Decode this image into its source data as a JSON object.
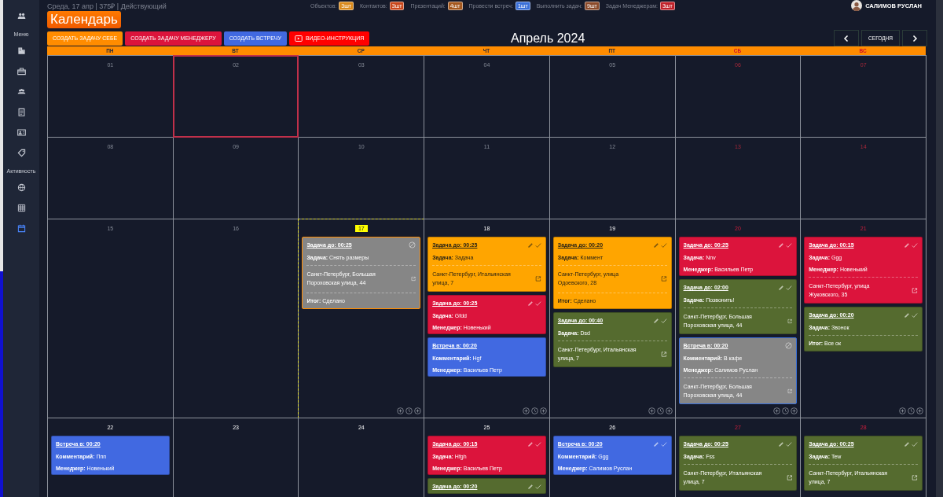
{
  "header": {
    "info": "Среда, 17 апр | 375₽ | Действующий",
    "counters": [
      {
        "label": "Объектов:",
        "count": "3шт",
        "color": "#d98a1c"
      },
      {
        "label": "Контактов:",
        "count": "3шт",
        "color": "#c8471c"
      },
      {
        "label": "Презентаций:",
        "count": "4шт",
        "color": "#a4581e"
      },
      {
        "label": "Провести встреч:",
        "count": "1шт",
        "color": "#3a6fd8"
      },
      {
        "label": "Выполнить задач:",
        "count": "9шт",
        "color": "#8b4a2a"
      },
      {
        "label": "Задач Менеджерам:",
        "count": "3шт",
        "color": "#c0222a"
      }
    ],
    "user": {
      "name": "САЛИМОВ РУСЛАН"
    }
  },
  "sidebar": {
    "top_items": [
      {
        "selected": false
      }
    ],
    "sections": [
      {
        "label": "Меню",
        "items": [
          {
            "selected": false
          },
          {
            "selected": false
          },
          {
            "selected": false
          },
          {
            "selected": false
          },
          {
            "selected": false
          },
          {
            "selected": false
          }
        ]
      },
      {
        "label": "Активность",
        "items": [
          {
            "selected": false
          },
          {
            "selected": false
          },
          {
            "selected": true
          }
        ]
      }
    ]
  },
  "title": "Календарь",
  "buttons": [
    {
      "label": "СОЗДАТЬ ЗАДАЧУ СЕБЕ",
      "color": "#ff8c00",
      "kind": "plain"
    },
    {
      "label": "СОЗДАТЬ ЗАДАЧУ МЕНЕДЖЕРУ",
      "color": "#dc143c",
      "kind": "plain"
    },
    {
      "label": "СОЗДАТЬ ВСТРЕЧУ",
      "color": "#4169e1",
      "kind": "plain"
    },
    {
      "label": "ВИДЕО-ИНСТРУКЦИЯ",
      "color": "#ff0000",
      "kind": "video"
    }
  ],
  "month": "Апрель 2024",
  "today_button": "СЕГОДНЯ",
  "weekdays": [
    {
      "label": "ПН",
      "weekend": false
    },
    {
      "label": "ВТ",
      "weekend": false
    },
    {
      "label": "СР",
      "weekend": false
    },
    {
      "label": "ЧТ",
      "weekend": false
    },
    {
      "label": "ПТ",
      "weekend": false
    },
    {
      "label": "СБ",
      "weekend": true
    },
    {
      "label": "ВС",
      "weekend": true
    }
  ],
  "weeks": [
    [
      {
        "number": "01",
        "past": true,
        "weekend": false,
        "today": false,
        "selected": false,
        "actions": false
      },
      {
        "number": "02",
        "past": true,
        "weekend": false,
        "today": false,
        "selected": true,
        "actions": false
      },
      {
        "number": "03",
        "past": true,
        "weekend": false,
        "today": false,
        "selected": false,
        "actions": false
      },
      {
        "number": "04",
        "past": true,
        "weekend": false,
        "today": false,
        "selected": false,
        "actions": false
      },
      {
        "number": "05",
        "past": true,
        "weekend": false,
        "today": false,
        "selected": false,
        "actions": false
      },
      {
        "number": "06",
        "past": true,
        "weekend": true,
        "today": false,
        "selected": false,
        "actions": false
      },
      {
        "number": "07",
        "past": true,
        "weekend": true,
        "today": false,
        "selected": false,
        "actions": false
      }
    ],
    [
      {
        "number": "08",
        "past": true,
        "weekend": false,
        "today": false,
        "selected": false,
        "actions": false
      },
      {
        "number": "09",
        "past": true,
        "weekend": false,
        "today": false,
        "selected": false,
        "actions": false
      },
      {
        "number": "10",
        "past": true,
        "weekend": false,
        "today": false,
        "selected": false,
        "actions": false
      },
      {
        "number": "11",
        "past": true,
        "weekend": false,
        "today": false,
        "selected": false,
        "actions": false
      },
      {
        "number": "12",
        "past": true,
        "weekend": false,
        "today": false,
        "selected": false,
        "actions": false
      },
      {
        "number": "13",
        "past": true,
        "weekend": true,
        "today": false,
        "selected": false,
        "actions": false
      },
      {
        "number": "14",
        "past": true,
        "weekend": true,
        "today": false,
        "selected": false,
        "actions": false
      }
    ],
    [
      {
        "number": "15",
        "past": true,
        "weekend": false,
        "today": false,
        "selected": false,
        "actions": false
      },
      {
        "number": "16",
        "past": true,
        "weekend": false,
        "today": false,
        "selected": false,
        "actions": false
      },
      {
        "number": "17",
        "past": false,
        "weekend": false,
        "today": true,
        "selected": false,
        "actions": true,
        "events": [
          {
            "kind": "task",
            "cancelled": true,
            "editable": false,
            "color": "#868686",
            "title": "Задача до: 00:25",
            "lines": [
              {
                "label": "Задача:",
                "value": "Снять размеры"
              }
            ],
            "address": "Санкт-Петербург, Большая Пороховская улица, 44",
            "result": {
              "label": "Итог:",
              "value": "Сделано"
            }
          }
        ]
      },
      {
        "number": "18",
        "past": false,
        "weekend": false,
        "today": false,
        "selected": false,
        "actions": true,
        "events": [
          {
            "kind": "task",
            "cancelled": false,
            "editable": true,
            "color": "#ffa500",
            "title": "Задача до: 00:25",
            "lines": [
              {
                "label": "Задача:",
                "value": "Задача"
              }
            ],
            "address": "Санкт-Петербург, Итальянская улица, 7"
          },
          {
            "kind": "task",
            "cancelled": false,
            "editable": true,
            "color": "#dc143c",
            "title": "Задача до: 00:25",
            "lines": [
              {
                "label": "Задача:",
                "value": "Gfdd"
              },
              {
                "label": "Менеджер:",
                "value": "Новенький"
              }
            ]
          },
          {
            "kind": "meeting",
            "cancelled": false,
            "editable": false,
            "color": "#4169e1",
            "title": "Встреча в: 00:20",
            "lines": [
              {
                "label": "Комментарий:",
                "value": "Hgf"
              },
              {
                "label": "Менеджер:",
                "value": "Васильев Петр"
              }
            ]
          }
        ]
      },
      {
        "number": "19",
        "past": false,
        "weekend": false,
        "today": false,
        "selected": false,
        "actions": true,
        "events": [
          {
            "kind": "task",
            "cancelled": false,
            "editable": true,
            "color": "#ffa500",
            "title": "Задача до: 00:20",
            "lines": [
              {
                "label": "Задача:",
                "value": "Коммент"
              }
            ],
            "address": "Санкт-Петербург, улица Одоевского, 28",
            "result": {
              "label": "Итог:",
              "value": "Сделано"
            }
          },
          {
            "kind": "task",
            "cancelled": false,
            "editable": true,
            "color": "#556b2f",
            "title": "Задача до: 00:40",
            "lines": [
              {
                "label": "Задача:",
                "value": "Dsd"
              }
            ],
            "address": "Санкт-Петербург, Итальянская улица, 7"
          }
        ]
      },
      {
        "number": "20",
        "past": false,
        "weekend": true,
        "today": false,
        "selected": false,
        "actions": true,
        "events": [
          {
            "kind": "task",
            "cancelled": false,
            "editable": true,
            "color": "#dc143c",
            "title": "Задача до: 00:25",
            "lines": [
              {
                "label": "Задача:",
                "value": "Nnv"
              },
              {
                "label": "Менеджер:",
                "value": "Васильев Петр"
              }
            ]
          },
          {
            "kind": "task",
            "cancelled": false,
            "editable": true,
            "color": "#556b2f",
            "title": "Задача до: 02:00",
            "lines": [
              {
                "label": "Задача:",
                "value": "Позвонить!"
              }
            ],
            "address": "Санкт-Петербург, Большая Пороховская улица, 44"
          },
          {
            "kind": "meeting",
            "cancelled": true,
            "editable": false,
            "color": "#868686",
            "title": "Встреча в: 00:20",
            "lines": [
              {
                "label": "Комментарий:",
                "value": "В кафе"
              },
              {
                "label": "Менеджер:",
                "value": "Салимов Руслан"
              }
            ],
            "address": "Санкт-Петербург, Большая Пороховская улица, 44"
          }
        ]
      },
      {
        "number": "21",
        "past": false,
        "weekend": true,
        "today": false,
        "selected": false,
        "actions": true,
        "events": [
          {
            "kind": "task",
            "cancelled": false,
            "editable": true,
            "color": "#dc143c",
            "title": "Задача до: 00:15",
            "lines": [
              {
                "label": "Задача:",
                "value": "Ggg"
              },
              {
                "label": "Менеджер:",
                "value": "Новенький"
              }
            ],
            "address": "Санкт-Петербург, улица Жуковского, 35"
          },
          {
            "kind": "task",
            "cancelled": false,
            "editable": true,
            "color": "#556b2f",
            "title": "Задача до: 00:20",
            "lines": [
              {
                "label": "Задача:",
                "value": "Звонок"
              }
            ],
            "result": {
              "label": "Итог:",
              "value": "Все ок"
            }
          }
        ]
      }
    ],
    [
      {
        "number": "22",
        "past": false,
        "weekend": false,
        "today": false,
        "selected": false,
        "actions": false,
        "events": [
          {
            "kind": "meeting",
            "cancelled": false,
            "editable": false,
            "color": "#4169e1",
            "title": "Встреча в: 00:20",
            "lines": [
              {
                "label": "Комментарий:",
                "value": "Ппп"
              },
              {
                "label": "Менеджер:",
                "value": "Новенький"
              }
            ]
          }
        ]
      },
      {
        "number": "23",
        "past": false,
        "weekend": false,
        "today": false,
        "selected": false,
        "actions": false
      },
      {
        "number": "24",
        "past": false,
        "weekend": false,
        "today": false,
        "selected": false,
        "actions": false
      },
      {
        "number": "25",
        "past": false,
        "weekend": false,
        "today": false,
        "selected": false,
        "actions": false,
        "events": [
          {
            "kind": "task",
            "cancelled": false,
            "editable": true,
            "color": "#dc143c",
            "title": "Задача до: 00:15",
            "lines": [
              {
                "label": "Задача:",
                "value": "Hfgh"
              },
              {
                "label": "Менеджер:",
                "value": "Васильев Петр"
              }
            ]
          },
          {
            "kind": "task",
            "cancelled": false,
            "editable": true,
            "color": "#556b2f",
            "title": "Задача до: 00:20"
          }
        ]
      },
      {
        "number": "26",
        "past": false,
        "weekend": false,
        "today": false,
        "selected": false,
        "actions": false,
        "events": [
          {
            "kind": "meeting",
            "cancelled": false,
            "editable": true,
            "color": "#4169e1",
            "title": "Встреча в: 00:20",
            "lines": [
              {
                "label": "Комментарий:",
                "value": "Ggg"
              },
              {
                "label": "Менеджер:",
                "value": "Салимов Руслан"
              }
            ]
          }
        ]
      },
      {
        "number": "27",
        "past": false,
        "weekend": true,
        "today": false,
        "selected": false,
        "actions": false,
        "events": [
          {
            "kind": "task",
            "cancelled": false,
            "editable": true,
            "color": "#556b2f",
            "title": "Задача до: 00:25",
            "lines": [
              {
                "label": "Задача:",
                "value": "Fss"
              }
            ],
            "address": "Санкт-Петербург, Итальянская улица, 7"
          }
        ]
      },
      {
        "number": "28",
        "past": false,
        "weekend": true,
        "today": false,
        "selected": false,
        "actions": false,
        "events": [
          {
            "kind": "task",
            "cancelled": false,
            "editable": true,
            "color": "#556b2f",
            "title": "Задача до: 00:25",
            "lines": [
              {
                "label": "Задача:",
                "value": "Tew"
              }
            ],
            "address": "Санкт-Петербург, Итальянская улица, 7"
          }
        ]
      }
    ]
  ]
}
